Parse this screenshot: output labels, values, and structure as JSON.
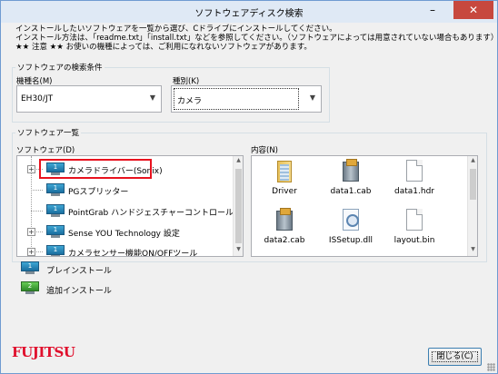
{
  "window": {
    "title": "ソフトウェアディスク検索",
    "minimize_glyph": "–",
    "close_glyph": "✕"
  },
  "instructions": [
    "インストールしたいソフトウェアを一覧から選び、Cドライブにインストールしてください。",
    "インストール方法は、「readme.txt」「install.txt」などを参照してください。（ソフトウェアによっては用意されていない場合もあります）",
    "★★ 注意 ★★ お使いの機種によっては、ご利用になれないソフトウェアがあります。"
  ],
  "search_conditions": {
    "group_label": "ソフトウェアの検索条件",
    "model_label": "機種名(M)",
    "model_value": "EH30/JT",
    "type_label": "種別(K)",
    "type_value": "カメラ"
  },
  "software_list": {
    "group_label": "ソフトウェア一覧",
    "software_label": "ソフトウェア(D)",
    "content_label": "内容(N)",
    "tree_items": [
      {
        "label": "カメラドライバー(Sonix)",
        "expandable": true,
        "icon": "preinstall-monitor-icon"
      },
      {
        "label": "PGスプリッター",
        "expandable": false,
        "icon": "preinstall-monitor-icon"
      },
      {
        "label": "PointGrab ハンドジェスチャーコントロール",
        "expandable": false,
        "icon": "preinstall-monitor-icon"
      },
      {
        "label": "Sense YOU Technology 設定",
        "expandable": true,
        "icon": "preinstall-monitor-icon"
      },
      {
        "label": "カメラセンサー機能ON/OFFツール",
        "expandable": true,
        "icon": "preinstall-monitor-icon"
      }
    ],
    "files": [
      {
        "name": "Driver",
        "icon": "folder-icon"
      },
      {
        "name": "data1.cab",
        "icon": "cab-archive-icon"
      },
      {
        "name": "data1.hdr",
        "icon": "document-icon"
      },
      {
        "name": "data2.cab",
        "icon": "cab-archive-icon"
      },
      {
        "name": "ISSetup.dll",
        "icon": "dll-icon"
      },
      {
        "name": "layout.bin",
        "icon": "document-icon"
      }
    ]
  },
  "legend": [
    {
      "label": "プレインストール",
      "badge": "1",
      "color": "#2c8fc4"
    },
    {
      "label": "追加インストール",
      "badge": "2",
      "color": "#3aa33a"
    }
  ],
  "brand": {
    "logo_text": "FUJITSU",
    "color": "#e0102d"
  },
  "close_button_label": "閉じる(C)"
}
